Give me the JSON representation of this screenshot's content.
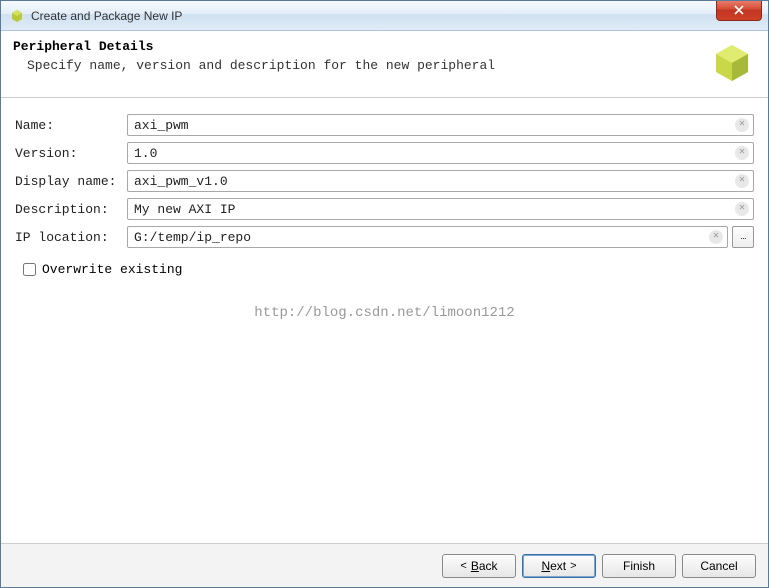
{
  "window": {
    "title": "Create and Package New IP"
  },
  "header": {
    "title": "Peripheral Details",
    "subtitle": "Specify name, version and description for the new peripheral"
  },
  "form": {
    "name_label": "Name:",
    "name_value": "axi_pwm",
    "version_label": "Version:",
    "version_value": "1.0",
    "display_name_label": "Display name:",
    "display_name_value": "axi_pwm_v1.0",
    "description_label": "Description:",
    "description_value": "My new AXI IP",
    "ip_location_label": "IP location:",
    "ip_location_value": "G:/temp/ip_repo",
    "overwrite_label": "Overwrite existing"
  },
  "watermark": "http://blog.csdn.net/limoon1212",
  "footer": {
    "back": "Back",
    "next": "Next",
    "finish": "Finish",
    "cancel": "Cancel"
  }
}
